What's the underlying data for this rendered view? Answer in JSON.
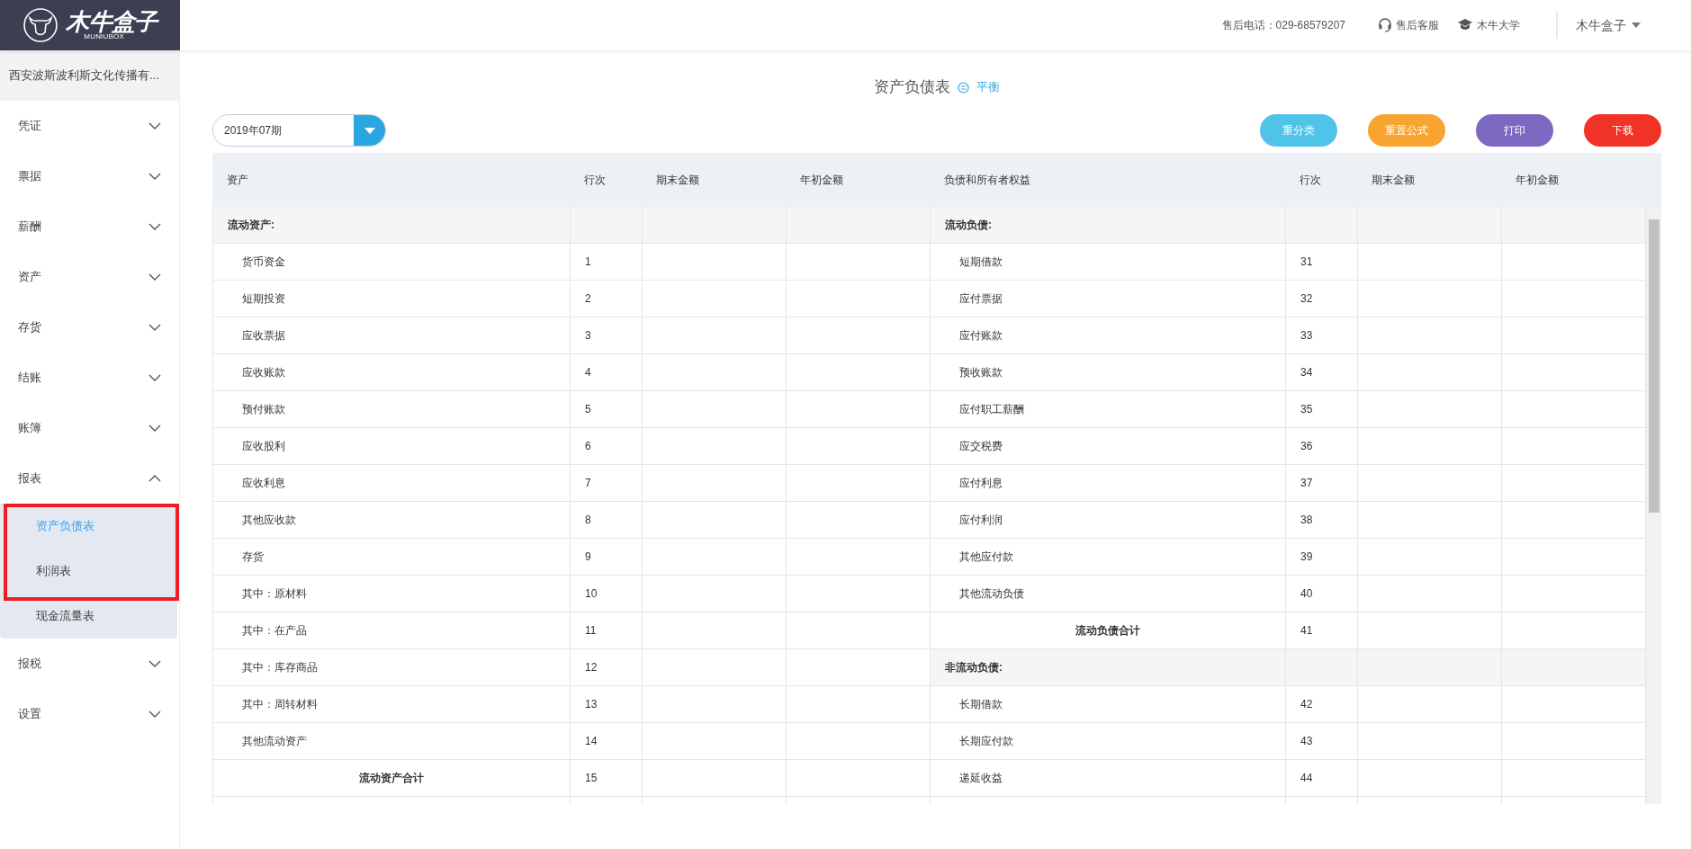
{
  "logo": {
    "name": "木牛盒子",
    "subtitle": "MUNIUBOX"
  },
  "header": {
    "phone": "售后电话：029-68579207",
    "links": [
      {
        "kind": "support",
        "label": "售后客服"
      },
      {
        "kind": "academy",
        "label": "木牛大学"
      }
    ],
    "user": "木牛盒子"
  },
  "company": "西安波斯波利斯文化传播有...",
  "sidebar": {
    "items": [
      {
        "label": "凭证",
        "expanded": false
      },
      {
        "label": "票据",
        "expanded": false
      },
      {
        "label": "薪酬",
        "expanded": false
      },
      {
        "label": "资产",
        "expanded": false
      },
      {
        "label": "存货",
        "expanded": false
      },
      {
        "label": "结账",
        "expanded": false
      },
      {
        "label": "账簿",
        "expanded": false
      },
      {
        "label": "报表",
        "expanded": true,
        "children": [
          {
            "label": "资产负债表",
            "selected": true
          },
          {
            "label": "利润表",
            "selected": false
          },
          {
            "label": "现金流量表",
            "selected": false
          }
        ]
      },
      {
        "label": "报税",
        "expanded": false
      },
      {
        "label": "设置",
        "expanded": false
      }
    ]
  },
  "title": "资产负债表",
  "balance_status": "平衡",
  "period": "2019年07期",
  "actions": [
    {
      "label": "重分类",
      "color": "#4fc3e8"
    },
    {
      "label": "重置公式",
      "color": "#f9a431"
    },
    {
      "label": "打印",
      "color": "#7b68c0"
    },
    {
      "label": "下载",
      "color": "#f03326"
    }
  ],
  "table": {
    "columns": [
      "资产",
      "行次",
      "期末金额",
      "年初金额",
      "负债和所有者权益",
      "行次",
      "期末金额",
      "年初金额"
    ],
    "rows": [
      {
        "asset": {
          "kind": "section",
          "label": "流动资产:"
        },
        "liability": {
          "kind": "section",
          "label": "流动负债:"
        }
      },
      {
        "asset": {
          "kind": "item",
          "label": "货币资金",
          "line": "1"
        },
        "liability": {
          "kind": "item",
          "label": "短期借款",
          "line": "31"
        }
      },
      {
        "asset": {
          "kind": "item",
          "label": "短期投资",
          "line": "2"
        },
        "liability": {
          "kind": "item",
          "label": "应付票据",
          "line": "32"
        }
      },
      {
        "asset": {
          "kind": "item",
          "label": "应收票据",
          "line": "3"
        },
        "liability": {
          "kind": "item",
          "label": "应付账款",
          "line": "33"
        }
      },
      {
        "asset": {
          "kind": "item",
          "label": "应收账款",
          "line": "4"
        },
        "liability": {
          "kind": "item",
          "label": "预收账款",
          "line": "34"
        }
      },
      {
        "asset": {
          "kind": "item",
          "label": "预付账款",
          "line": "5"
        },
        "liability": {
          "kind": "item",
          "label": "应付职工薪酬",
          "line": "35"
        }
      },
      {
        "asset": {
          "kind": "item",
          "label": "应收股利",
          "line": "6"
        },
        "liability": {
          "kind": "item",
          "label": "应交税费",
          "line": "36"
        }
      },
      {
        "asset": {
          "kind": "item",
          "label": "应收利息",
          "line": "7"
        },
        "liability": {
          "kind": "item",
          "label": "应付利息",
          "line": "37"
        }
      },
      {
        "asset": {
          "kind": "item",
          "label": "其他应收款",
          "line": "8"
        },
        "liability": {
          "kind": "item",
          "label": "应付利润",
          "line": "38"
        }
      },
      {
        "asset": {
          "kind": "item",
          "label": "存货",
          "line": "9"
        },
        "liability": {
          "kind": "item",
          "label": "其他应付款",
          "line": "39"
        }
      },
      {
        "asset": {
          "kind": "item",
          "label": "其中：原材料",
          "line": "10"
        },
        "liability": {
          "kind": "item",
          "label": "其他流动负债",
          "line": "40"
        }
      },
      {
        "asset": {
          "kind": "item",
          "label": "其中：在产品",
          "line": "11"
        },
        "liability": {
          "kind": "total",
          "label": "流动负债合计",
          "line": "41"
        }
      },
      {
        "asset": {
          "kind": "item",
          "label": "其中：库存商品",
          "line": "12"
        },
        "liability": {
          "kind": "section",
          "label": "非流动负债:"
        }
      },
      {
        "asset": {
          "kind": "item",
          "label": "其中：周转材料",
          "line": "13"
        },
        "liability": {
          "kind": "item",
          "label": "长期借款",
          "line": "42"
        }
      },
      {
        "asset": {
          "kind": "item",
          "label": "其他流动资产",
          "line": "14"
        },
        "liability": {
          "kind": "item",
          "label": "长期应付款",
          "line": "43"
        }
      },
      {
        "asset": {
          "kind": "total",
          "label": "流动资产合计",
          "line": "15"
        },
        "liability": {
          "kind": "item",
          "label": "递延收益",
          "line": "44"
        }
      }
    ]
  }
}
